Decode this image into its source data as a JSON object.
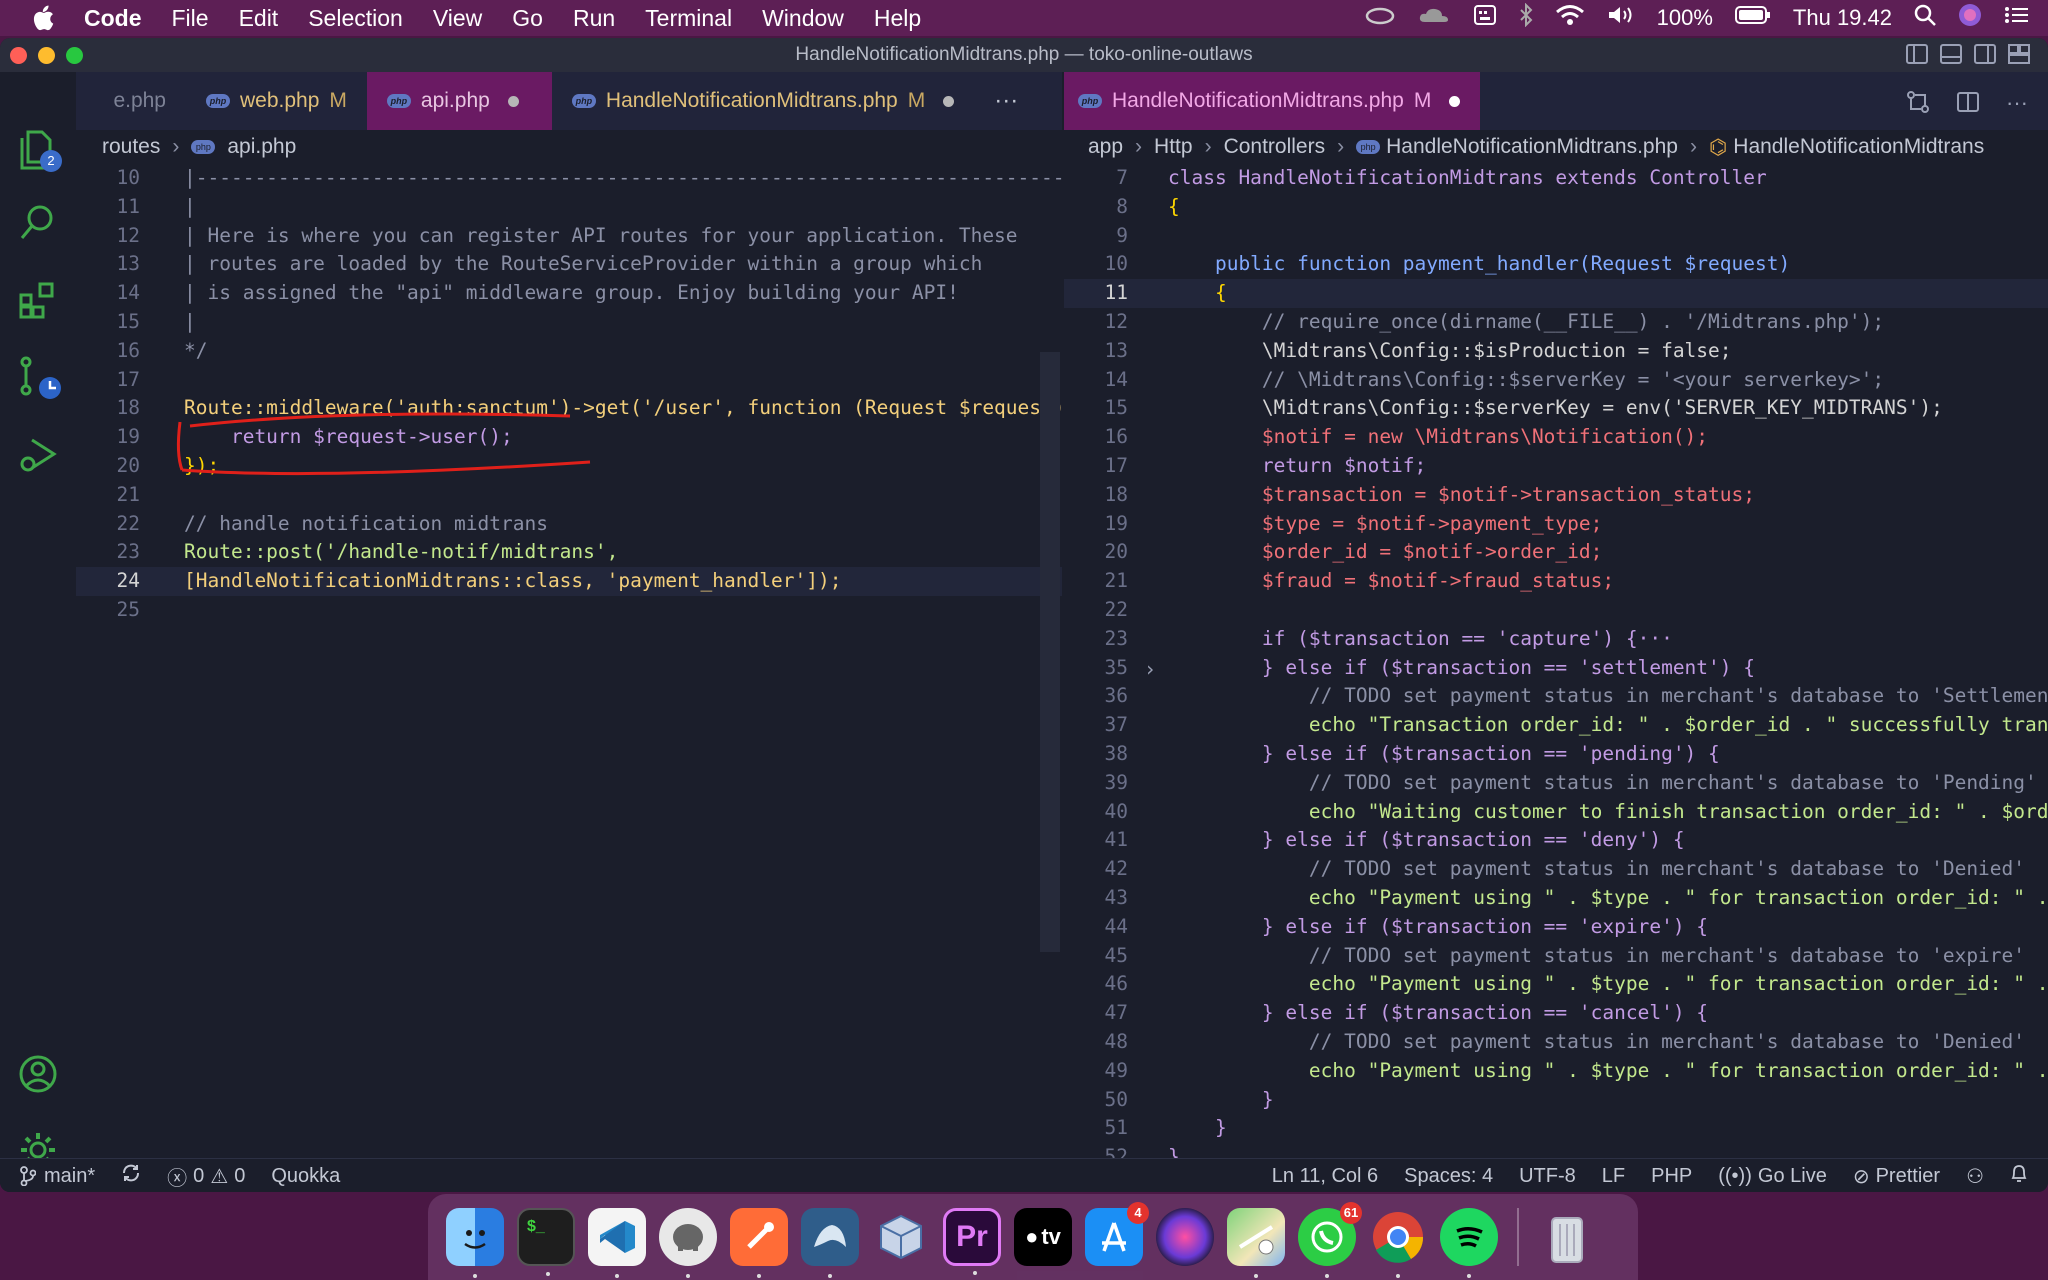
{
  "menubar": {
    "app_name": "Code",
    "items": [
      "File",
      "Edit",
      "Selection",
      "View",
      "Go",
      "Run",
      "Terminal",
      "Window",
      "Help"
    ],
    "battery": "100%",
    "clock": "Thu 19.42"
  },
  "window": {
    "title": "HandleNotificationMidtrans.php — toko-online-outlaws"
  },
  "activity": {
    "explorer_badge": "2"
  },
  "left_editor": {
    "tabs": [
      {
        "label": "e.php",
        "modified": ""
      },
      {
        "label": "web.php",
        "modified": "M"
      },
      {
        "label": "api.php",
        "modified": ""
      },
      {
        "label": "HandleNotificationMidtrans.php",
        "modified": "M"
      }
    ],
    "more": "···",
    "breadcrumb": [
      "routes",
      "api.php"
    ],
    "lines": [
      {
        "n": "10",
        "t": "|--------------------------------------------------------------------------"
      },
      {
        "n": "11",
        "t": "|"
      },
      {
        "n": "12",
        "t": "| Here is where you can register API routes for your application. These"
      },
      {
        "n": "13",
        "t": "| routes are loaded by the RouteServiceProvider within a group which"
      },
      {
        "n": "14",
        "t": "| is assigned the \"api\" middleware group. Enjoy building your API!"
      },
      {
        "n": "15",
        "t": "|"
      },
      {
        "n": "16",
        "t": "*/"
      },
      {
        "n": "17",
        "t": ""
      },
      {
        "n": "18",
        "t": "Route::middleware('auth:sanctum')->get('/user', function (Request $request)"
      },
      {
        "n": "19",
        "t": "    return $request->user();"
      },
      {
        "n": "20",
        "t": "});"
      },
      {
        "n": "21",
        "t": ""
      },
      {
        "n": "22",
        "t": "// handle notification midtrans"
      },
      {
        "n": "23",
        "t": "Route::post('/handle-notif/midtrans',"
      },
      {
        "n": "24",
        "t": "[HandleNotificationMidtrans::class, 'payment_handler']);"
      },
      {
        "n": "25",
        "t": ""
      }
    ]
  },
  "right_editor": {
    "tab": {
      "label": "HandleNotificationMidtrans.php",
      "modified": "M"
    },
    "breadcrumb": [
      "app",
      "Http",
      "Controllers",
      "HandleNotificationMidtrans.php",
      "HandleNotificationMidtrans"
    ],
    "lines": [
      {
        "n": "7",
        "t": "class HandleNotificationMidtrans extends Controller"
      },
      {
        "n": "8",
        "t": "{"
      },
      {
        "n": "9",
        "t": ""
      },
      {
        "n": "10",
        "t": "    public function payment_handler(Request $request)"
      },
      {
        "n": "11",
        "t": "    {"
      },
      {
        "n": "12",
        "t": "        // require_once(dirname(__FILE__) . '/Midtrans.php');"
      },
      {
        "n": "13",
        "t": "        \\Midtrans\\Config::$isProduction = false;"
      },
      {
        "n": "14",
        "t": "        // \\Midtrans\\Config::$serverKey = '<your serverkey>';"
      },
      {
        "n": "15",
        "t": "        \\Midtrans\\Config::$serverKey = env('SERVER_KEY_MIDTRANS');"
      },
      {
        "n": "16",
        "t": "        $notif = new \\Midtrans\\Notification();"
      },
      {
        "n": "17",
        "t": "        return $notif;"
      },
      {
        "n": "18",
        "t": "        $transaction = $notif->transaction_status;"
      },
      {
        "n": "19",
        "t": "        $type = $notif->payment_type;"
      },
      {
        "n": "20",
        "t": "        $order_id = $notif->order_id;"
      },
      {
        "n": "21",
        "t": "        $fraud = $notif->fraud_status;"
      },
      {
        "n": "22",
        "t": ""
      },
      {
        "n": "23",
        "t": "        if ($transaction == 'capture') {···"
      },
      {
        "n": "35",
        "t": "        } else if ($transaction == 'settlement') {"
      },
      {
        "n": "36",
        "t": "            // TODO set payment status in merchant's database to 'Settlement"
      },
      {
        "n": "37",
        "t": "            echo \"Transaction order_id: \" . $order_id . \" successfully trans"
      },
      {
        "n": "38",
        "t": "        } else if ($transaction == 'pending') {"
      },
      {
        "n": "39",
        "t": "            // TODO set payment status in merchant's database to 'Pending'"
      },
      {
        "n": "40",
        "t": "            echo \"Waiting customer to finish transaction order_id: \" . $orde"
      },
      {
        "n": "41",
        "t": "        } else if ($transaction == 'deny') {"
      },
      {
        "n": "42",
        "t": "            // TODO set payment status in merchant's database to 'Denied'"
      },
      {
        "n": "43",
        "t": "            echo \"Payment using \" . $type . \" for transaction order_id: \" ."
      },
      {
        "n": "44",
        "t": "        } else if ($transaction == 'expire') {"
      },
      {
        "n": "45",
        "t": "            // TODO set payment status in merchant's database to 'expire'"
      },
      {
        "n": "46",
        "t": "            echo \"Payment using \" . $type . \" for transaction order_id: \" ."
      },
      {
        "n": "47",
        "t": "        } else if ($transaction == 'cancel') {"
      },
      {
        "n": "48",
        "t": "            // TODO set payment status in merchant's database to 'Denied'"
      },
      {
        "n": "49",
        "t": "            echo \"Payment using \" . $type . \" for transaction order_id: \" ."
      },
      {
        "n": "50",
        "t": "        }"
      },
      {
        "n": "51",
        "t": "    }"
      },
      {
        "n": "52",
        "t": "}"
      }
    ]
  },
  "statusbar": {
    "branch": "main*",
    "errors": "0",
    "warnings": "0",
    "quokka": "Quokka",
    "position": "Ln 11, Col 6",
    "spaces": "Spaces: 4",
    "encoding": "UTF-8",
    "eol": "LF",
    "language": "PHP",
    "go_live": "Go Live",
    "prettier": "Prettier"
  },
  "dock": {
    "apps": [
      "finder-icon",
      "terminal-icon",
      "vscode-icon",
      "tableplus-icon",
      "postman-icon",
      "mysql-workbench-icon",
      "virtualbox-icon",
      "premiere-icon",
      "apple-tv-icon",
      "app-store-icon",
      "siri-icon",
      "maps-icon",
      "whatsapp-icon",
      "chrome-icon",
      "spotify-icon",
      "trash-icon"
    ],
    "premiere_label": "Pr",
    "tv_label": "tv",
    "app_store_badge": "4",
    "whatsapp_badge": "61"
  },
  "colors": {
    "accent_tab": "#6a1a63",
    "editor_bg": "#1b1e2b",
    "annotation": "#e0201a"
  }
}
